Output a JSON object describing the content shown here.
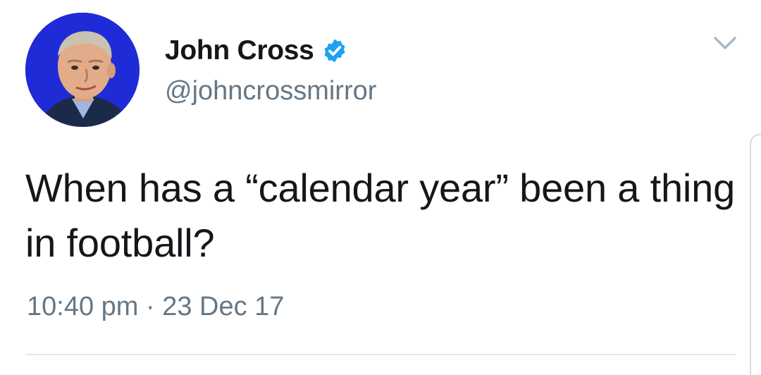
{
  "tweet": {
    "author": {
      "display_name": "John Cross",
      "handle": "@johncrossmirror",
      "verified": true,
      "avatar_icon": "profile-photo"
    },
    "text": "When has a “calendar year” been a thing in football?",
    "timestamp": "10:40 pm · 23 Dec 17",
    "menu_icon": "chevron-down-icon"
  },
  "colors": {
    "text_primary": "#14171a",
    "text_secondary": "#657786",
    "verified_blue": "#1da1f2",
    "avatar_bg": "#1f2bd6"
  }
}
